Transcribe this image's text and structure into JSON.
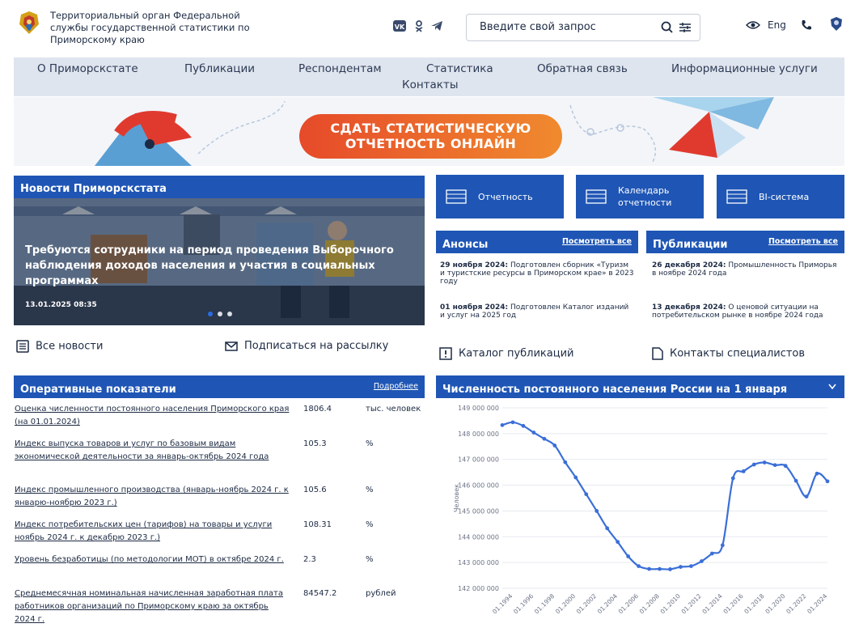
{
  "header": {
    "org_name": "Территориальный орган Федеральной службы государственной статистики по Приморскому краю",
    "search_placeholder": "Введите свой запрос",
    "lang": "Eng"
  },
  "nav": {
    "items": [
      "О Приморскстате",
      "Публикации",
      "Респондентам",
      "Статистика",
      "Обратная связь",
      "Информационные услуги",
      "Контакты"
    ]
  },
  "banner": {
    "cta_line1": "СДАТЬ СТАТИСТИЧЕСКУЮ",
    "cta_line2": "ОТЧЕТНОСТЬ ОНЛАЙН"
  },
  "news": {
    "title": "Новости Приморскстата",
    "headline": "Требуются сотрудники на период проведения Выборочного наблюдения доходов населения и участия в социальных программах",
    "date": "13.01.2025 08:35",
    "all_news": "Все новости",
    "subscribe": "Подписаться на рассылку"
  },
  "quick": {
    "reports": "Отчетность",
    "calendar": "Календарь отчетности",
    "bi": "BI-система"
  },
  "announcements": {
    "title": "Анонсы",
    "see_all": "Посмотреть все",
    "items": [
      {
        "date": "29 ноября 2024:",
        "text": " Подготовлен сборник «Туризм и туристские ресурсы в Приморском крае» в 2023 году"
      },
      {
        "date": "01 ноября 2024:",
        "text": " Подготовлен Каталог изданий и услуг на 2025 год"
      }
    ],
    "catalog": "Каталог публикаций"
  },
  "publications": {
    "title": "Публикации",
    "see_all": "Посмотреть все",
    "items": [
      {
        "date": "26 декабря 2024:",
        "text": " Промышленность Приморья в ноябре 2024 года"
      },
      {
        "date": "13 декабря 2024:",
        "text": " О ценовой ситуации на потребительском рынке в ноябре 2024 года"
      }
    ],
    "contacts": "Контакты специалистов"
  },
  "indicators": {
    "title": "Оперативные показатели",
    "more": "Подробнее",
    "rows": [
      {
        "name": "Оценка численности постоянного населения Приморского края (на 01.01.2024)",
        "value": "1806.4",
        "unit": "тыс. человек"
      },
      {
        "name": "Индекс выпуска товаров и услуг по базовым видам экономической деятельности за январь-октябрь 2024 года",
        "value": "105.3",
        "unit": "%"
      },
      {
        "name": "Индекс промышленного производства (январь-ноябрь 2024 г. к январю-ноябрю 2023 г.)",
        "value": "105.6",
        "unit": "%"
      },
      {
        "name": "Индекс потребительских цен (тарифов) на товары и услуги ноябрь 2024 г. к декабрю 2023 г.)",
        "value": "108.31",
        "unit": "%"
      },
      {
        "name": "Уровень безработицы (по методологии МОТ) в октябре 2024 г.",
        "value": "2.3",
        "unit": "%"
      },
      {
        "name": "Среднемесячная номинальная начисленная заработная плата работников организаций по Приморскому краю за октябрь 2024 г.",
        "value": "84547.2",
        "unit": "рублей"
      }
    ]
  },
  "chart_data": {
    "type": "line",
    "title": "Численность постоянного населения России на 1 января",
    "ylabel": "Человек",
    "ylim": [
      142000000,
      149000000
    ],
    "yticks": [
      "149 000 000",
      "148 000 000",
      "147 000 000",
      "146 000 000",
      "145 000 000",
      "144 000 000",
      "143 000 000",
      "142 000 000"
    ],
    "xticks": [
      "01.1994",
      "01.1996",
      "01.1998",
      "01.2000",
      "01.2002",
      "01.2004",
      "01.2006",
      "01.2008",
      "01.2010",
      "01.2012",
      "01.2014",
      "01.2016",
      "01.2018",
      "01.2020",
      "01.2022",
      "01.2024"
    ],
    "x": [
      1993,
      1994,
      1995,
      1996,
      1997,
      1998,
      1999,
      2000,
      2001,
      2002,
      2003,
      2004,
      2005,
      2006,
      2007,
      2008,
      2009,
      2010,
      2011,
      2012,
      2013,
      2014,
      2015,
      2016,
      2017,
      2018,
      2019,
      2020,
      2021,
      2022,
      2023,
      2024
    ],
    "values": [
      148330000,
      148440000,
      148300000,
      148040000,
      147800000,
      147540000,
      146890000,
      146300000,
      145650000,
      145000000,
      144330000,
      143800000,
      143240000,
      142860000,
      142750000,
      142750000,
      142740000,
      142830000,
      142860000,
      143050000,
      143350000,
      143670000,
      146270000,
      146540000,
      146800000,
      146880000,
      146780000,
      146750000,
      146170000,
      145560000,
      146450000,
      146150000
    ],
    "color": "#3b6fd8"
  },
  "colors": {
    "brand_blue": "#1f56b5",
    "nav_bg": "#dfe5ee",
    "cta_orange": "#f08a2e",
    "cta_red": "#e64a2a"
  }
}
